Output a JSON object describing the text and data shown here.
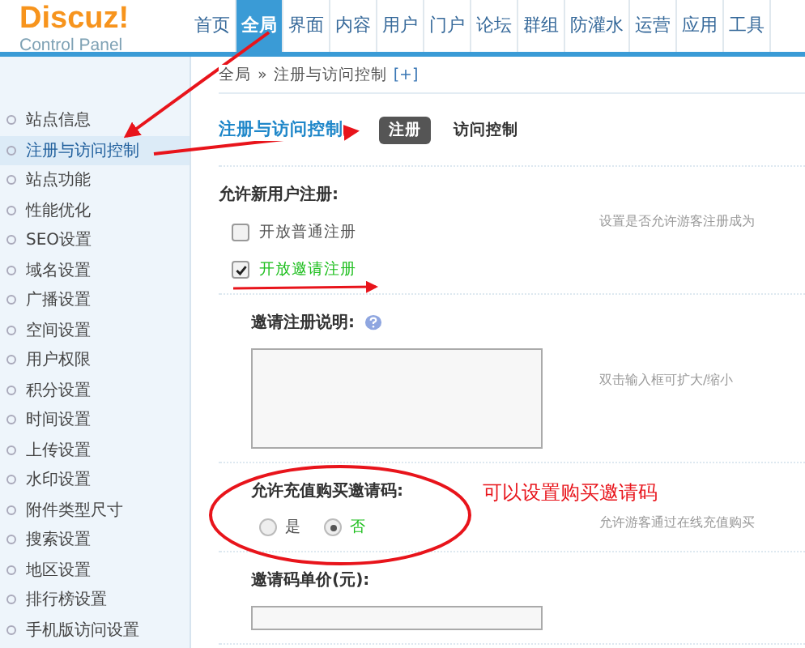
{
  "logo": {
    "name": "Discuz!",
    "subtitle": "Control Panel"
  },
  "nav": [
    {
      "label": "首页",
      "selected": false
    },
    {
      "label": "全局",
      "selected": true
    },
    {
      "label": "界面",
      "selected": false
    },
    {
      "label": "内容",
      "selected": false
    },
    {
      "label": "用户",
      "selected": false
    },
    {
      "label": "门户",
      "selected": false
    },
    {
      "label": "论坛",
      "selected": false
    },
    {
      "label": "群组",
      "selected": false
    },
    {
      "label": "防灌水",
      "selected": false
    },
    {
      "label": "运营",
      "selected": false
    },
    {
      "label": "应用",
      "selected": false
    },
    {
      "label": "工具",
      "selected": false
    }
  ],
  "breadcrumb": {
    "root": "全局",
    "separator": "»",
    "current": "注册与访问控制",
    "add": "[+]"
  },
  "sidebar": {
    "items": [
      {
        "label": "站点信息",
        "selected": false
      },
      {
        "label": "注册与访问控制",
        "selected": true
      },
      {
        "label": "站点功能",
        "selected": false
      },
      {
        "label": "性能优化",
        "selected": false
      },
      {
        "label": "SEO设置",
        "selected": false
      },
      {
        "label": "域名设置",
        "selected": false
      },
      {
        "label": "广播设置",
        "selected": false
      },
      {
        "label": "空间设置",
        "selected": false
      },
      {
        "label": "用户权限",
        "selected": false
      },
      {
        "label": "积分设置",
        "selected": false
      },
      {
        "label": "时间设置",
        "selected": false
      },
      {
        "label": "上传设置",
        "selected": false
      },
      {
        "label": "水印设置",
        "selected": false
      },
      {
        "label": "附件类型尺寸",
        "selected": false
      },
      {
        "label": "搜索设置",
        "selected": false
      },
      {
        "label": "地区设置",
        "selected": false
      },
      {
        "label": "排行榜设置",
        "selected": false
      },
      {
        "label": "手机版访问设置",
        "selected": false
      }
    ]
  },
  "page": {
    "title": "注册与访问控制",
    "tabs": [
      {
        "label": "注册",
        "selected": true
      },
      {
        "label": "访问控制",
        "selected": false
      }
    ]
  },
  "sections": [
    {
      "kind": "checkboxes",
      "label": "允许新用户注册:",
      "hint": "设置是否允许游客注册成为",
      "options": [
        {
          "label": "开放普通注册",
          "checked": false
        },
        {
          "label": "开放邀请注册",
          "checked": true
        }
      ]
    },
    {
      "kind": "textarea",
      "label": "邀请注册说明:",
      "hint": "双击输入框可扩大/缩小"
    },
    {
      "kind": "radios",
      "label": "允许充值购买邀请码:",
      "hint": "允许游客通过在线充值购买",
      "options": [
        {
          "label": "是",
          "selected": false
        },
        {
          "label": "否",
          "selected": true
        }
      ]
    },
    {
      "kind": "input",
      "label": "邀请码单价(元):"
    }
  ],
  "annotation": {
    "text": "可以设置购买邀请码"
  }
}
